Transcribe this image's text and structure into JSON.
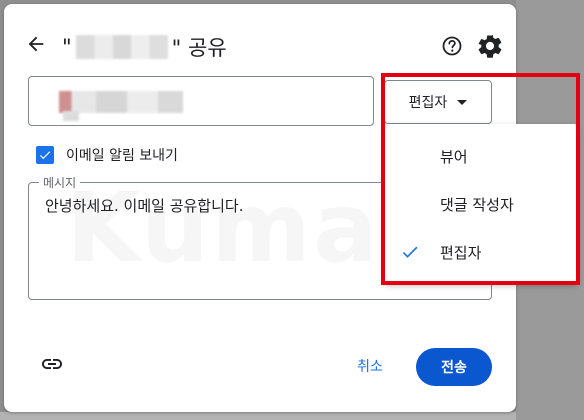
{
  "dialog": {
    "title_prefix": "\"",
    "title_suffix": "\" 공유",
    "role_selected": "편집자",
    "notify_label": "이메일 알림 보내기",
    "message_label": "메시지",
    "message_text": "안녕하세요. 이메일 공유합니다.",
    "watermark": "Kuma",
    "cancel_label": "취소",
    "send_label": "전송"
  },
  "role_menu": {
    "items": [
      {
        "label": "뷰어",
        "selected": false
      },
      {
        "label": "댓글 작성자",
        "selected": false
      },
      {
        "label": "편집자",
        "selected": true
      }
    ]
  },
  "colors": {
    "primary": "#0b57d0",
    "checkbox": "#1a73e8",
    "highlight": "#e4000f"
  },
  "icons": {
    "back": "arrow-left-icon",
    "help": "help-circle-icon",
    "settings": "gear-icon",
    "link": "link-icon",
    "check": "check-icon"
  }
}
